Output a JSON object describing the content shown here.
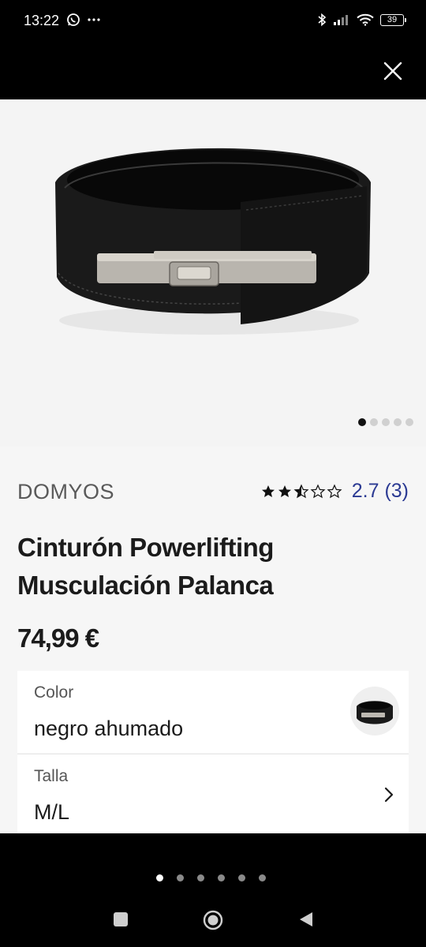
{
  "status_bar": {
    "time": "13:22",
    "battery": "39",
    "icons": [
      "whatsapp-icon",
      "more-dots-icon",
      "bluetooth-icon",
      "signal-icon",
      "wifi-icon",
      "battery-icon"
    ]
  },
  "top_bar": {
    "close_icon": "close-icon"
  },
  "product": {
    "image_dots": {
      "count": 5,
      "active_index": 0
    },
    "brand": "DOMYOS",
    "rating": {
      "stars": 2.7,
      "value_text": "2.7",
      "count_text": "(3)"
    },
    "title": "Cinturón Powerlifting Musculación Palanca",
    "price": "74,99 €",
    "options": {
      "color": {
        "label": "Color",
        "value": "negro ahumado"
      },
      "size": {
        "label": "Talla",
        "value": "M/L"
      }
    }
  },
  "bottom": {
    "page_dots": {
      "count": 6,
      "active_index": 0
    },
    "nav": [
      "recents-square-icon",
      "home-circle-icon",
      "back-triangle-icon"
    ]
  },
  "colors": {
    "accent": "#2b3a93",
    "text": "#1b1b1b",
    "muted": "#5a5a5a",
    "background": "#f6f6f6"
  }
}
